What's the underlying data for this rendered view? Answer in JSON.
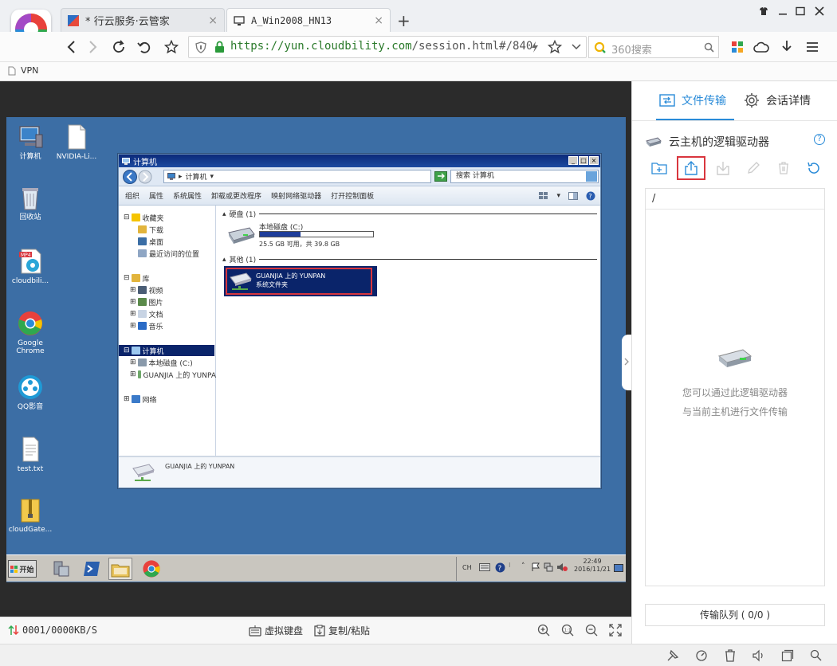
{
  "browser": {
    "tabs": [
      {
        "label": "* 行云服务·云管家",
        "close": "×"
      },
      {
        "label": "A_Win2008_HN13",
        "close": "×"
      }
    ],
    "new_tab": "+",
    "url_host": "https://yun.cloudbility.com",
    "url_path": "/session.html#/840",
    "search_placeholder": "360搜索",
    "bookmarks": [
      {
        "label": "VPN"
      }
    ]
  },
  "remote": {
    "desktop_icons": [
      {
        "label": "计算机"
      },
      {
        "label": "NVIDIA-Li..."
      },
      {
        "label": "回收站"
      },
      {
        "label": "cloudbili..."
      },
      {
        "label": "Google Chrome"
      },
      {
        "label": "QQ影音"
      },
      {
        "label": "test.txt"
      },
      {
        "label": "cloudGate..."
      }
    ],
    "explorer": {
      "title": "计算机",
      "address": "计算机",
      "search_placeholder": "搜索 计算机",
      "toolbar": [
        "组织",
        "属性",
        "系统属性",
        "卸载或更改程序",
        "映射网络驱动器",
        "打开控制面板"
      ],
      "tree": {
        "favorites": "收藏夹",
        "downloads": "下载",
        "desktop": "桌面",
        "recent": "最近访问的位置",
        "libraries": "库",
        "videos": "视频",
        "pictures": "图片",
        "documents": "文档",
        "music": "音乐",
        "computer": "计算机",
        "local_disk": "本地磁盘 (C:)",
        "guanjia": "GUANJIA 上的 YUNPA",
        "network": "网络"
      },
      "groups": {
        "hdd": "硬盘 (1)",
        "other": "其他 (1)"
      },
      "disk_c": {
        "name": "本地磁盘 (C:)",
        "space": "25.5 GB 可用，共 39.8 GB",
        "used_fraction": 0.36
      },
      "yunpan": {
        "name": "GUANJIA 上的 YUNPAN",
        "type": "系统文件夹"
      },
      "status_name": "GUANJIA 上的 YUNPAN"
    },
    "taskbar": {
      "start": "开始",
      "ime": "CH",
      "time": "22:49",
      "date": "2016/11/21"
    },
    "status": {
      "transfer": "0001/0000KB/S",
      "keyboard": "虚拟键盘",
      "copy_paste": "复制/粘贴"
    }
  },
  "panel": {
    "tab_transfer": "文件传输",
    "tab_details": "会话详情",
    "drive_title": "云主机的逻辑驱动器",
    "help": "?",
    "path": "/",
    "empty_line1": "您可以通过此逻辑驱动器",
    "empty_line2": "与当前主机进行文件传输",
    "queue": "传输队列 ( 0/0 )"
  },
  "colors": {
    "accent": "#2a8bd8",
    "highlight_border": "#d9363e",
    "desktop_bg": "#3c6ea5"
  }
}
